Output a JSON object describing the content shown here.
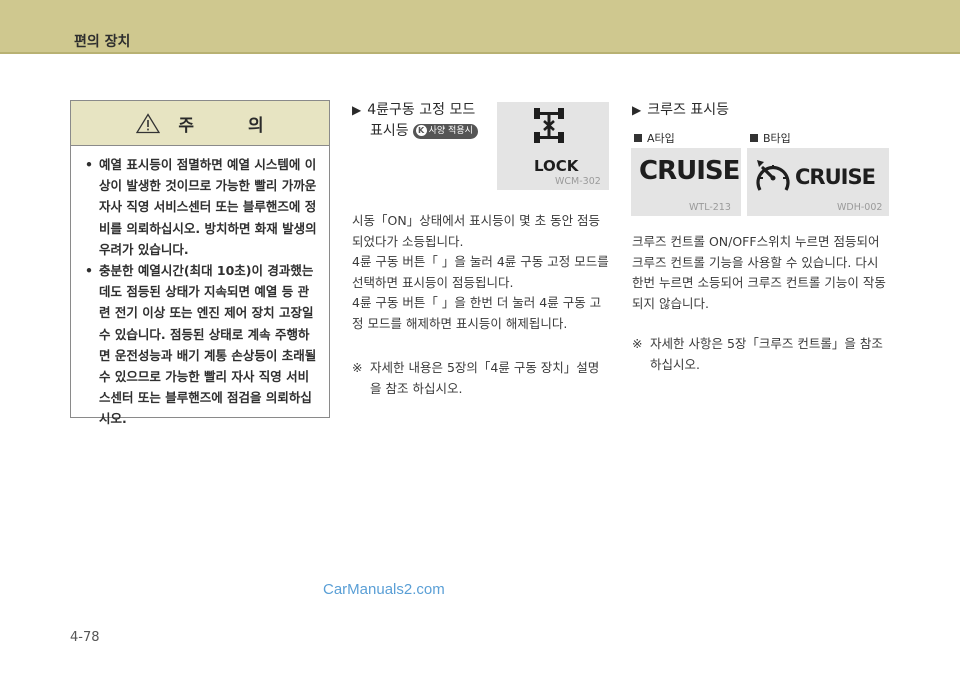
{
  "header": {
    "title": "편의 장치"
  },
  "caution": {
    "title": "주 의",
    "items": [
      "예열 표시등이 점멸하면 예열 시스템에 이상이 발생한 것이므로 가능한 빨리 가까운 자사 직영 서비스센터 또는 블루핸즈에 정비를 의뢰하십시오. 방치하면 화재 발생의 우려가 있습니다.",
      "충분한 예열시간(최대 10초)이 경과했는데도 점등된 상태가 지속되면 예열 등 관련 전기 이상 또는 엔진 제어 장치 고장일 수 있습니다. 점등된 상태로 계속 주행하면 운전성능과 배기 계통 손상등이 초래될 수 있으므로 가능한 빨리 자사 직영 서비스센터 또는 블루핸즈에 점검을 의뢰하십시오."
    ]
  },
  "lock_section": {
    "title_line1": "4륜구동 고정 모드",
    "title_line2": "표시등",
    "badge": "사양 적용시",
    "badge_icon": "K",
    "image_text": "LOCK",
    "image_code": "WCM-302",
    "body": [
      "시동「ON」상태에서 표시등이 몇 초 동안 점등되었다가 소등됩니다.",
      "4륜 구동 버튼「  」을 눌러 4륜 구동 고정 모드를 선택하면 표시등이 점등됩니다.",
      "4륜 구동 버튼「  」을 한번 더 눌러 4륜 구동 고정 모드를 해제하면 표시등이 해제됩니다."
    ],
    "note_mark": "※",
    "note": "자세한 내용은 5장의「4륜 구동 장치」설명을 참조 하십시오."
  },
  "cruise_section": {
    "title": "크루즈 표시등",
    "type_a": {
      "label": "A타입",
      "image_text": "CRUISE",
      "image_code": "WTL-213"
    },
    "type_b": {
      "label": "B타입",
      "image_text": "CRUISE",
      "image_code": "WDH-002"
    },
    "body": "크루즈 컨트롤 ON/OFF스위치 누르면 점등되어 크루즈 컨트롤 기능을 사용할 수 있습니다. 다시 한번 누르면 소등되어 크루즈 컨트롤 기능이 작동되지 않습니다.",
    "note_mark": "※",
    "note": "자세한 사항은 5장「크루즈 컨트롤」을 참조하십시오."
  },
  "page_number": "4-78",
  "watermark": "CarManuals2.com",
  "colors": {
    "header": "#cfc88f",
    "caution_header": "#e7e4c2",
    "image_bg": "#e4e4e4"
  }
}
